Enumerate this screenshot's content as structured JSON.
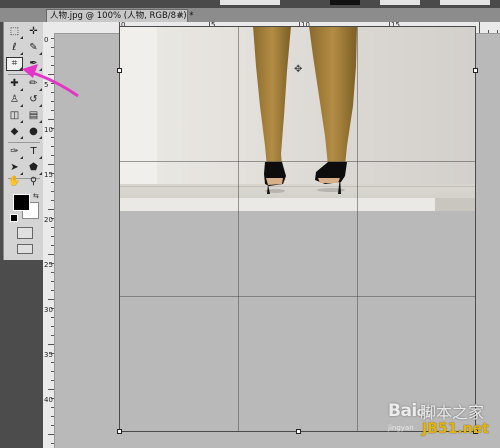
{
  "document": {
    "tab_title": "人物.jpg @ 100% (人物, RGB/8#) *",
    "tab_close": "×"
  },
  "toolbox": {
    "selected_tool": "crop-tool",
    "tools": [
      {
        "name": "marquee-tool",
        "glyph": "⬚"
      },
      {
        "name": "move-tool",
        "glyph": "✛"
      },
      {
        "name": "lasso-tool",
        "glyph": "ℓ"
      },
      {
        "name": "quick-select-tool",
        "glyph": "✎"
      },
      {
        "name": "crop-tool",
        "glyph": "⌗"
      },
      {
        "name": "eyedropper-tool",
        "glyph": "✒"
      },
      {
        "name": "healing-tool",
        "glyph": "✚"
      },
      {
        "name": "brush-tool",
        "glyph": "✏"
      },
      {
        "name": "stamp-tool",
        "glyph": "♙"
      },
      {
        "name": "history-brush-tool",
        "glyph": "↺"
      },
      {
        "name": "eraser-tool",
        "glyph": "◫"
      },
      {
        "name": "gradient-tool",
        "glyph": "▤"
      },
      {
        "name": "blur-tool",
        "glyph": "◆"
      },
      {
        "name": "dodge-tool",
        "glyph": "●"
      },
      {
        "name": "pen-tool",
        "glyph": "✑"
      },
      {
        "name": "type-tool",
        "glyph": "T"
      },
      {
        "name": "path-select-tool",
        "glyph": "➤"
      },
      {
        "name": "shape-tool",
        "glyph": "⬟"
      },
      {
        "name": "hand-tool",
        "glyph": "✋"
      },
      {
        "name": "zoom-tool",
        "glyph": "🔍"
      }
    ],
    "foreground_color": "#000000",
    "background_color": "#ffffff"
  },
  "rulers": {
    "top_numbers": [
      "0",
      "5",
      "10",
      "15"
    ],
    "left_numbers": [
      "0",
      "5",
      "10",
      "15",
      "20",
      "25",
      "30",
      "35",
      "40"
    ]
  },
  "colors": {
    "annotation_arrow": "#e535c8",
    "watermark_site": "#e8b400"
  },
  "watermark": {
    "brand": "Bai",
    "brand_suffix": "du",
    "sub": "jingyan",
    "cn_text": "脚本之家",
    "site": "JB51.net"
  }
}
